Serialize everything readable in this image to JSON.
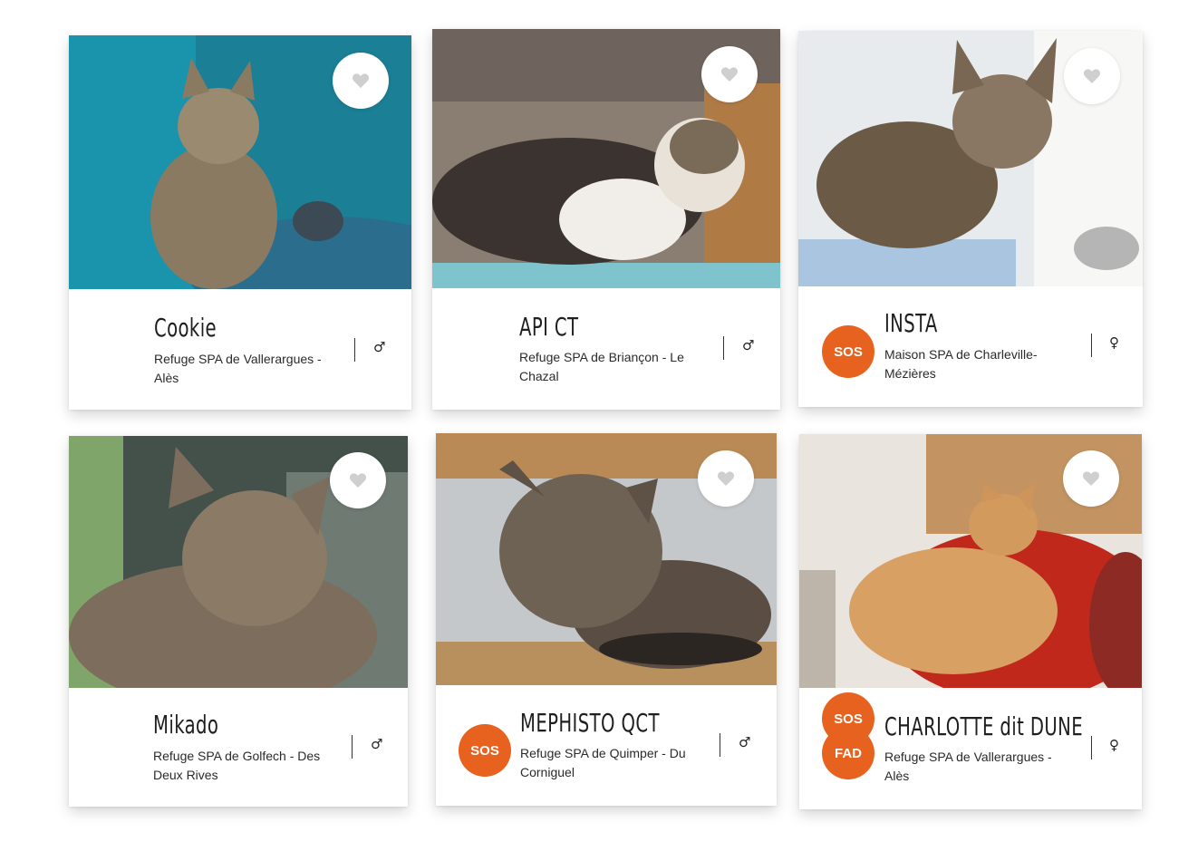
{
  "cards": [
    {
      "name": "Cookie",
      "shelter": "Refuge SPA de Vallerargues - Alès",
      "sex_symbol": "♂",
      "badges": []
    },
    {
      "name": "API CT",
      "shelter": "Refuge SPA de Briançon - Le Chazal",
      "sex_symbol": "♂",
      "badges": []
    },
    {
      "name": "INSTA",
      "shelter": "Maison SPA de Charleville-Mézières",
      "sex_symbol": "♀",
      "badges": [
        "SOS"
      ]
    },
    {
      "name": "Mikado",
      "shelter": "Refuge SPA de Golfech - Des Deux Rives",
      "sex_symbol": "♂",
      "badges": []
    },
    {
      "name": "MEPHISTO QCT",
      "shelter": "Refuge SPA de Quimper - Du Corniguel",
      "sex_symbol": "♂",
      "badges": [
        "SOS"
      ]
    },
    {
      "name": "CHARLOTTE dit DUNE",
      "shelter": "Refuge SPA de Vallerargues - Alès",
      "sex_symbol": "♀",
      "badges": [
        "SOS",
        "FAD"
      ]
    }
  ],
  "icons": {
    "favorite": "heart-icon",
    "male": "male-icon",
    "female": "female-icon"
  },
  "colors": {
    "badge": "#e8621f",
    "heart": "#cfcfcf"
  }
}
